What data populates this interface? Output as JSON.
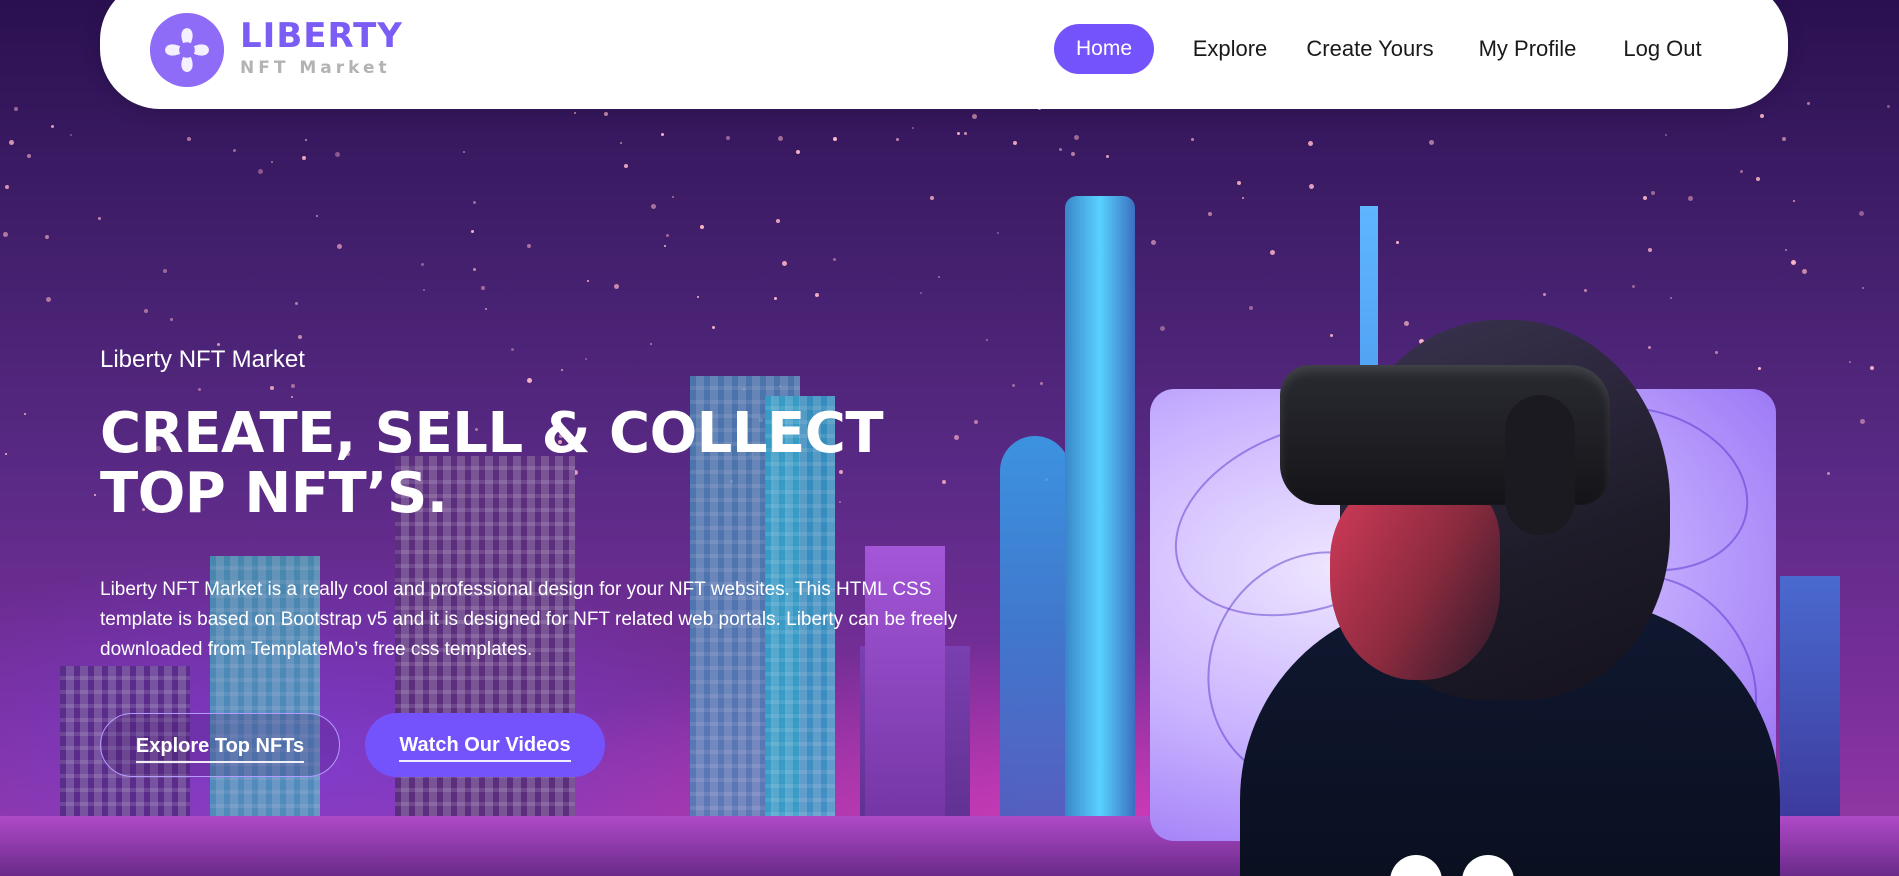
{
  "brand": {
    "name": "LIBERTY",
    "subtitle": "NFT Market",
    "logo_icon": "liberty-swirl-logo"
  },
  "nav": {
    "items": [
      {
        "label": "Home",
        "active": true
      },
      {
        "label": "Explore",
        "active": false
      },
      {
        "label": "Create Yours",
        "active": false
      },
      {
        "label": "My Profile",
        "active": false
      },
      {
        "label": "Log Out",
        "active": false
      }
    ]
  },
  "hero": {
    "eyebrow": "Liberty NFT Market",
    "headline": "CREATE, SELL & COLLECT TOP NFT’S.",
    "description": "Liberty NFT Market is a really cool and professional design for your NFT websites. This HTML CSS template is based on Bootstrap v5 and it is designed for NFT related web portals. Liberty can be freely downloaded from TemplateMo’s free css templates.",
    "buttons": {
      "primary": "Explore Top NFTs",
      "secondary": "Watch Our Videos"
    }
  },
  "colors": {
    "accent": "#7453fc",
    "brand_text": "#7b5cf5",
    "brand_sub": "#b3b3b3",
    "nav_bg": "#ffffff",
    "hero_bg": "#44206e"
  }
}
